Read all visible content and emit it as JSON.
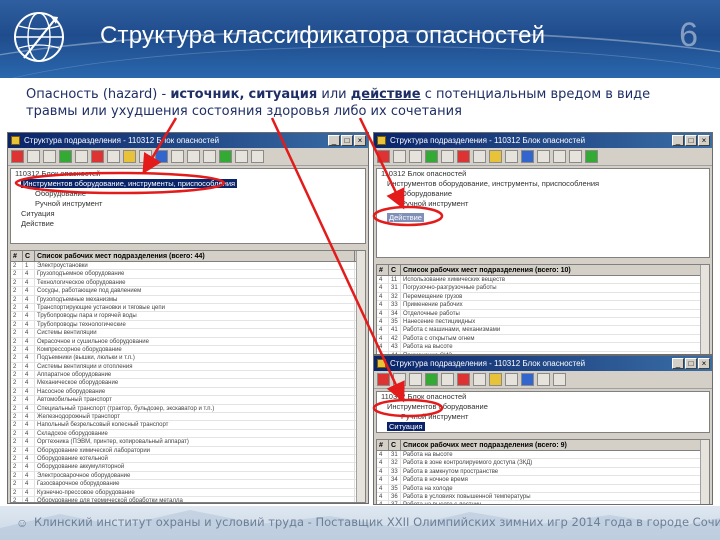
{
  "header": {
    "title": "Структура классификатора опасностей",
    "slide_number": "6"
  },
  "definition": {
    "term": "Опасность",
    "term_en": "(hazard)",
    "dash": "-",
    "source": "источник",
    "comma": ",",
    "situation": "ситуация",
    "or": "или",
    "action": "действие",
    "rest": "с потенциальным вредом в виде травмы или ухудшения состояния здоровья либо их сочетания"
  },
  "window_left": {
    "title": "Структура подразделения - 110312 Блок опасностей",
    "tree": [
      "110312 Блок опасностей",
      "Инструментов оборудование, инструменты, приспособления",
      "Оборудование",
      "Ручной инструмент",
      "Ситуация",
      "Действие"
    ],
    "grid_header": [
      "#",
      "С",
      "Список рабочих мест подразделения (всего: 44)"
    ],
    "rows": [
      {
        "a": "2",
        "b": "1",
        "c": "Электроустановки"
      },
      {
        "a": "2",
        "b": "4",
        "c": "Грузоподъемное оборудование"
      },
      {
        "a": "2",
        "b": "4",
        "c": "Технологическое оборудование"
      },
      {
        "a": "2",
        "b": "4",
        "c": "Сосуды, работающие под давлением"
      },
      {
        "a": "2",
        "b": "4",
        "c": "Грузоподъемные механизмы"
      },
      {
        "a": "2",
        "b": "4",
        "c": "Транспортирующие установки и тяговые цепи"
      },
      {
        "a": "2",
        "b": "4",
        "c": "Трубопроводы пара и горячей воды"
      },
      {
        "a": "2",
        "b": "4",
        "c": "Трубопроводы технологические"
      },
      {
        "a": "2",
        "b": "4",
        "c": "Системы вентиляции"
      },
      {
        "a": "2",
        "b": "4",
        "c": "Окрасочное и сушильное оборудование"
      },
      {
        "a": "2",
        "b": "4",
        "c": "Компрессорное оборудование"
      },
      {
        "a": "2",
        "b": "4",
        "c": "Подъемники (вышки, люльки и т.п.)"
      },
      {
        "a": "2",
        "b": "4",
        "c": "Системы вентиляции и отопления"
      },
      {
        "a": "2",
        "b": "4",
        "c": "Аппаратное оборудование"
      },
      {
        "a": "2",
        "b": "4",
        "c": "Механическое оборудование"
      },
      {
        "a": "2",
        "b": "4",
        "c": "Насосное оборудование"
      },
      {
        "a": "2",
        "b": "4",
        "c": "Автомобильный транспорт"
      },
      {
        "a": "2",
        "b": "4",
        "c": "Специальный транспорт (трактор, бульдозер, экскаватор и т.п.)"
      },
      {
        "a": "2",
        "b": "4",
        "c": "Железнодорожный транспорт"
      },
      {
        "a": "2",
        "b": "4",
        "c": "Напольный безрельсовый колесный транспорт"
      },
      {
        "a": "2",
        "b": "4",
        "c": "Складское оборудование"
      },
      {
        "a": "2",
        "b": "4",
        "c": "Оргтехника (ПЭВМ, принтер, копировальный аппарат)"
      },
      {
        "a": "2",
        "b": "4",
        "c": "Оборудование химической лаборатории"
      },
      {
        "a": "2",
        "b": "4",
        "c": "Оборудование котельной"
      },
      {
        "a": "2",
        "b": "4",
        "c": "Оборудование аккумуляторной"
      },
      {
        "a": "2",
        "b": "4",
        "c": "Электросварочное оборудование"
      },
      {
        "a": "2",
        "b": "4",
        "c": "Газосварочное оборудование"
      },
      {
        "a": "2",
        "b": "4",
        "c": "Кузнечно-прессовое оборудование"
      },
      {
        "a": "2",
        "b": "4",
        "c": "Оборудование для термической обработки металла"
      },
      {
        "a": "2",
        "b": "4",
        "c": "Оборудование для литейного производства"
      }
    ]
  },
  "window_top_right": {
    "title": "Структура подразделения - 110312 Блок опасностей",
    "tree": [
      "110312 Блок опасностей",
      "Инструментов оборудование, инструменты, приспособления",
      "Оборудование",
      "Ручной инструмент",
      "Действие"
    ],
    "grid_header": [
      "#",
      "С",
      "Список рабочих мест подразделения (всего: 10)"
    ],
    "rows": [
      {
        "a": "4",
        "b": "11",
        "c": "Использование химических веществ"
      },
      {
        "a": "4",
        "b": "31",
        "c": "Погрузочно-разгрузочные работы"
      },
      {
        "a": "4",
        "b": "32",
        "c": "Перемещение грузов"
      },
      {
        "a": "4",
        "b": "33",
        "c": "Применение рабочих"
      },
      {
        "a": "4",
        "b": "34",
        "c": "Отделочные работы"
      },
      {
        "a": "4",
        "b": "35",
        "c": "Нанесение пестициидных"
      },
      {
        "a": "4",
        "b": "41",
        "c": "Работа с машинами, механизмами"
      },
      {
        "a": "4",
        "b": "42",
        "c": "Работа с открытым огнем"
      },
      {
        "a": "4",
        "b": "43",
        "c": "Работа на высоте"
      },
      {
        "a": "4",
        "b": "44",
        "c": "Применение СИЗ"
      }
    ]
  },
  "window_bottom_right": {
    "title": "Структура подразделения - 110312 Блок опасностей",
    "tree": [
      "110312 Блок опасностей",
      "Инструментов оборудование",
      "Ручной инструмент",
      "Ситуация"
    ],
    "grid_header": [
      "#",
      "С",
      "Список рабочих мест подразделения (всего: 9)"
    ],
    "rows": [
      {
        "a": "4",
        "b": "31",
        "c": "Работа на высоте"
      },
      {
        "a": "4",
        "b": "32",
        "c": "Работа в зоне контролируемого доступа (ЗКД)"
      },
      {
        "a": "4",
        "b": "33",
        "c": "Работа в замкнутом пространстве"
      },
      {
        "a": "4",
        "b": "34",
        "c": "Работа в ночное время"
      },
      {
        "a": "4",
        "b": "35",
        "c": "Работа на холоде"
      },
      {
        "a": "4",
        "b": "36",
        "c": "Работа в условиях повышенной температуры"
      },
      {
        "a": "4",
        "b": "37",
        "c": "Работа на высоте с лестниц"
      },
      {
        "a": "4",
        "b": "38",
        "c": "Пребывание в производственном помещении в условиях"
      }
    ]
  },
  "footer": {
    "text": "Клинский институт охраны и условий труда - Поставщик XXII Олимпийских зимних игр 2014 года в городе Сочи"
  },
  "colors": {
    "header_blue": "#1f4c8c",
    "arrow_red": "#e31b1b",
    "selection_blue": "#0a246a"
  }
}
